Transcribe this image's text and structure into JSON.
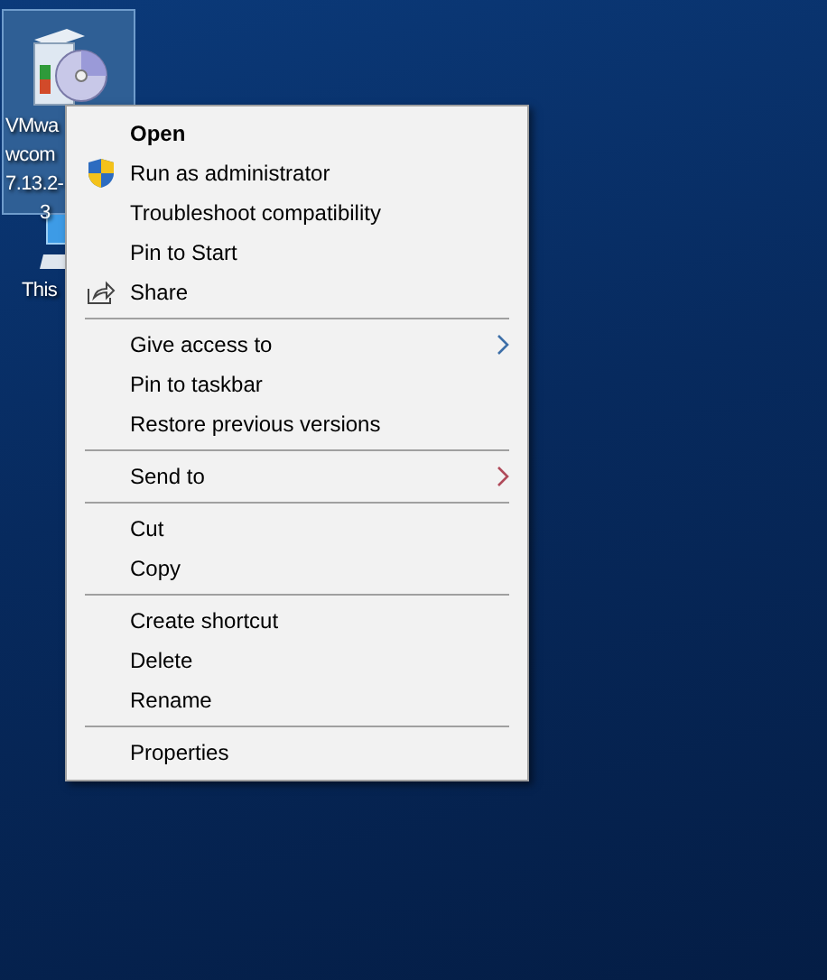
{
  "desktop_icons": [
    {
      "kind": "installer",
      "label_lines": [
        "VMwa",
        "wcom",
        "7.13.2-",
        "3"
      ],
      "selected": true
    },
    {
      "kind": "computer",
      "label_lines": [
        "This"
      ],
      "selected": false
    }
  ],
  "context_menu": {
    "groups": [
      {
        "items": [
          {
            "label": "Open",
            "bold": true,
            "kind": "plain"
          },
          {
            "label": "Run as administrator",
            "bold": false,
            "kind": "shield"
          },
          {
            "label": "Troubleshoot compatibility",
            "bold": false,
            "kind": "plain"
          },
          {
            "label": "Pin to Start",
            "bold": false,
            "kind": "plain"
          },
          {
            "label": "Share",
            "bold": false,
            "kind": "share"
          }
        ]
      },
      {
        "items": [
          {
            "label": "Give access to",
            "bold": false,
            "kind": "submenu",
            "color": "#3d6fa8"
          },
          {
            "label": "Pin to taskbar",
            "bold": false,
            "kind": "plain"
          },
          {
            "label": "Restore previous versions",
            "bold": false,
            "kind": "plain"
          }
        ]
      },
      {
        "items": [
          {
            "label": "Send to",
            "bold": false,
            "kind": "submenu",
            "color": "#b04a5a"
          }
        ]
      },
      {
        "items": [
          {
            "label": "Cut",
            "bold": false,
            "kind": "plain"
          },
          {
            "label": "Copy",
            "bold": false,
            "kind": "plain"
          }
        ]
      },
      {
        "items": [
          {
            "label": "Create shortcut",
            "bold": false,
            "kind": "plain"
          },
          {
            "label": "Delete",
            "bold": false,
            "kind": "plain"
          },
          {
            "label": "Rename",
            "bold": false,
            "kind": "plain"
          }
        ]
      },
      {
        "items": [
          {
            "label": "Properties",
            "bold": false,
            "kind": "plain"
          }
        ]
      }
    ]
  }
}
